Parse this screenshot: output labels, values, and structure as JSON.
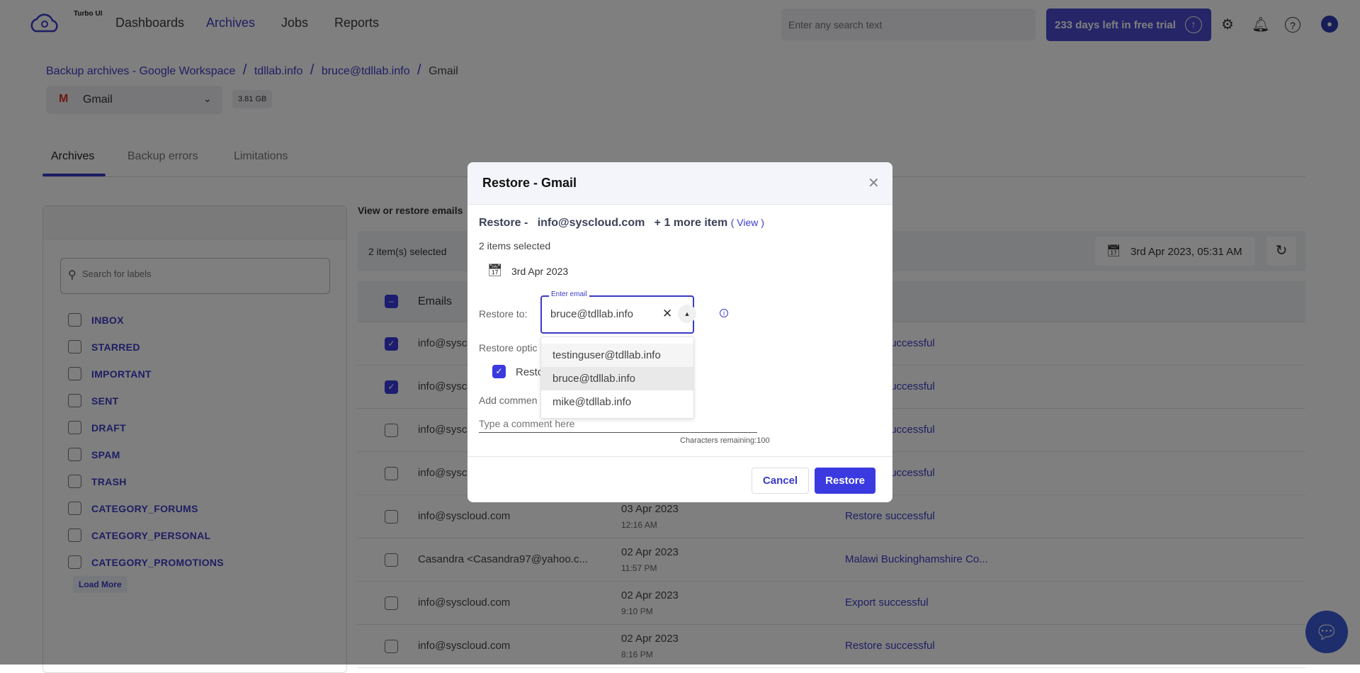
{
  "app": {
    "logo_text": "Turbo UI"
  },
  "nav": {
    "items": [
      {
        "label": "Dashboards"
      },
      {
        "label": "Archives",
        "active": true
      },
      {
        "label": "Jobs"
      },
      {
        "label": "Reports"
      }
    ],
    "search_placeholder": "Enter any search text",
    "trial_label": "233 days left in free trial"
  },
  "icons": {
    "settings": "gear-icon",
    "notifications": "bell-icon",
    "help": "question-icon",
    "avatar": "user-icon"
  },
  "breadcrumb": [
    {
      "label": "Backup archives - Google Workspace"
    },
    {
      "label": "tdllab.info"
    },
    {
      "label": "bruce@tdllab.info"
    },
    {
      "label": "Gmail"
    }
  ],
  "service_select": {
    "value": "Gmail",
    "size": "3.81 GB"
  },
  "tabs": [
    {
      "label": "Archives",
      "active": true
    },
    {
      "label": "Backup errors"
    },
    {
      "label": "Limitations"
    }
  ],
  "labels_panel": {
    "search_placeholder": "Search for labels",
    "items": [
      "INBOX",
      "STARRED",
      "IMPORTANT",
      "SENT",
      "DRAFT",
      "SPAM",
      "TRASH",
      "CATEGORY_FORUMS",
      "CATEGORY_PERSONAL",
      "CATEGORY_PROMOTIONS"
    ],
    "load_more": "Load More"
  },
  "main": {
    "title": "View or restore emails",
    "selected_count": "2 item(s) selected",
    "date_filter": "3rd Apr 2023, 05:31 AM",
    "column_emails": "Emails",
    "rows": [
      {
        "email": "info@syscloud.com",
        "date": "",
        "time": "",
        "status": "Restore successful",
        "checked": true
      },
      {
        "email": "info@syscloud.com",
        "date": "",
        "time": "",
        "status": "Restore successful",
        "checked": true
      },
      {
        "email": "info@syscloud.com",
        "date": "",
        "time": "",
        "status": "Restore successful",
        "checked": false
      },
      {
        "email": "info@syscloud.com",
        "date": "",
        "time": "",
        "status": "Restore successful",
        "checked": false
      },
      {
        "email": "info@syscloud.com",
        "date": "03 Apr 2023",
        "time": "12:16 AM",
        "status": "Restore successful",
        "checked": false
      },
      {
        "email": "Casandra <Casandra97@yahoo.c...",
        "date": "02 Apr 2023",
        "time": "11:57 PM",
        "status": "Malawi Buckinghamshire Co...",
        "checked": false
      },
      {
        "email": "info@syscloud.com",
        "date": "02 Apr 2023",
        "time": "9:10 PM",
        "status": "Export successful",
        "checked": false
      },
      {
        "email": "info@syscloud.com",
        "date": "02 Apr 2023",
        "time": "8:16 PM",
        "status": "Restore successful",
        "checked": false
      }
    ]
  },
  "modal": {
    "title": "Restore - Gmail",
    "restore_prefix": "Restore - ",
    "restore_item": "info@syscloud.com",
    "more": "+ 1 more item",
    "view_link": "( View )",
    "items_selected": "2 items selected",
    "date": "3rd Apr 2023",
    "restore_to_label": "Restore to:",
    "email_field_label": "Enter email",
    "email_value": "bruce@tdllab.info",
    "options_label": "Restore optic",
    "option_checkbox_label": "Resto",
    "comment_label": "Add commen",
    "comment_placeholder": "Type a comment here",
    "chars_remaining": "Characters remaining:100",
    "dropdown": [
      "testinguser@tdllab.info",
      "bruce@tdllab.info",
      "mike@tdllab.info"
    ],
    "cancel": "Cancel",
    "restore": "Restore"
  },
  "colors": {
    "accent": "#3a3ae0",
    "link": "#3d3dc8",
    "trial_bg": "#4a4ad0"
  }
}
